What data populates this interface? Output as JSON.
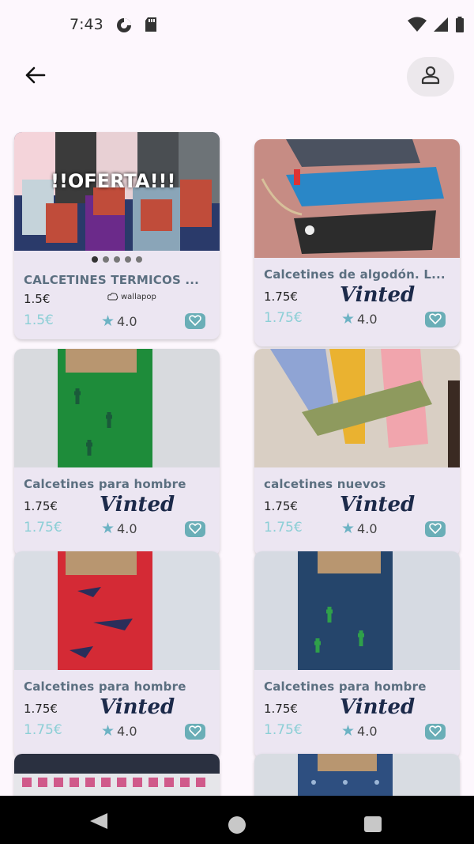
{
  "status_bar": {
    "time": "7:43",
    "left_icons": [
      "data-saver-icon",
      "sd-card-icon"
    ],
    "right_icons": [
      "wifi-icon",
      "signal-icon",
      "battery-icon"
    ]
  },
  "app_bar": {
    "back_icon": "arrow-left-icon",
    "profile_icon": "person-icon"
  },
  "products": [
    {
      "image_text": "!!OFERTA!!!",
      "title": "CALCETINES TERMICOS ...",
      "price": "1.5€",
      "price_accent": "1.5€",
      "source": "wallapop",
      "rating": "4.0",
      "carousel_dots": 5,
      "carousel_active": 0,
      "featured": true
    },
    {
      "title": "Calcetines de algodón. L...",
      "price": "1.75€",
      "price_accent": "1.75€",
      "source": "Vinted",
      "rating": "4.0"
    },
    {
      "title": "Calcetines para hombre",
      "price": "1.75€",
      "price_accent": "1.75€",
      "source": "Vinted",
      "rating": "4.0"
    },
    {
      "title": "calcetines nuevos",
      "price": "1.75€",
      "price_accent": "1.75€",
      "source": "Vinted",
      "rating": "4.0"
    },
    {
      "title": "Calcetines para hombre",
      "price": "1.75€",
      "price_accent": "1.75€",
      "source": "Vinted",
      "rating": "4.0"
    },
    {
      "title": "Calcetines para hombre",
      "price": "1.75€",
      "price_accent": "1.75€",
      "source": "Vinted",
      "rating": "4.0"
    }
  ],
  "colors": {
    "background": "#fdf7fd",
    "card": "#ece6f2",
    "title": "#5b6f80",
    "accent_price": "#8ccfd6",
    "fav_button": "#6aaeb7",
    "star": "#6db3c4"
  },
  "nav_bar": {
    "icons": [
      "back-triangle-icon",
      "home-circle-icon",
      "recents-square-icon"
    ]
  }
}
